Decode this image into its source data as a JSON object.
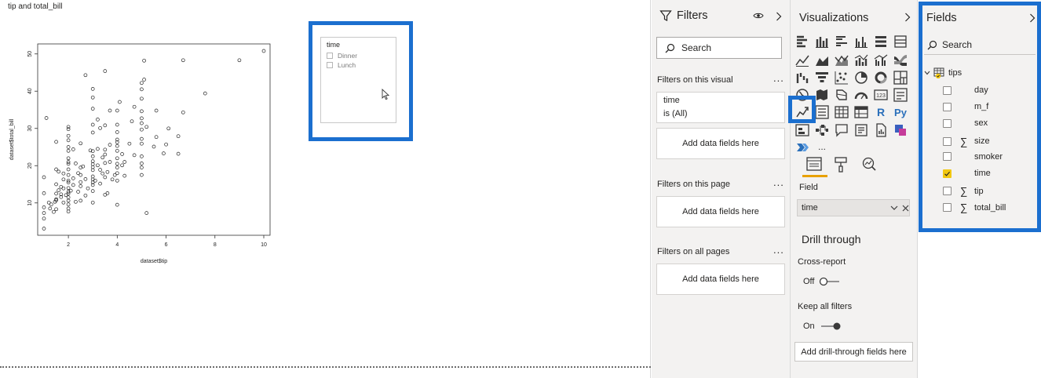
{
  "canvas": {
    "visual_title": "tip and total_bill",
    "slicer": {
      "title": "time",
      "items": [
        "Dinner",
        "Lunch"
      ]
    }
  },
  "chart_data": {
    "type": "scatter",
    "title": "",
    "xlabel": "dataset$tip",
    "ylabel": "dataset$total_bill",
    "xlim": [
      1,
      10
    ],
    "ylim": [
      3,
      51
    ],
    "x_ticks": [
      "2",
      "4",
      "6",
      "8",
      "10"
    ],
    "y_ticks": [
      "10",
      "20",
      "30",
      "40",
      "50"
    ],
    "grid": false,
    "legend": "none",
    "points": [
      [
        1.0,
        3.1
      ],
      [
        1.0,
        5.8
      ],
      [
        1.0,
        7.3
      ],
      [
        1.0,
        8.8
      ],
      [
        1.0,
        12.6
      ],
      [
        1.0,
        16.9
      ],
      [
        1.1,
        32.8
      ],
      [
        1.2,
        10.1
      ],
      [
        1.25,
        8.5
      ],
      [
        1.3,
        9.6
      ],
      [
        1.4,
        7.6
      ],
      [
        1.45,
        10.3
      ],
      [
        1.5,
        8.3
      ],
      [
        1.5,
        10.7
      ],
      [
        1.5,
        11.0
      ],
      [
        1.5,
        12.5
      ],
      [
        1.5,
        15.0
      ],
      [
        1.5,
        19.0
      ],
      [
        1.5,
        26.4
      ],
      [
        1.6,
        13.4
      ],
      [
        1.6,
        18.4
      ],
      [
        1.7,
        11.6
      ],
      [
        1.7,
        12.3
      ],
      [
        1.7,
        14.3
      ],
      [
        1.8,
        10.1
      ],
      [
        1.8,
        13.9
      ],
      [
        1.8,
        16.3
      ],
      [
        1.8,
        17.9
      ],
      [
        1.9,
        12.1
      ],
      [
        2.0,
        7.7
      ],
      [
        2.0,
        8.5
      ],
      [
        2.0,
        9.6
      ],
      [
        2.0,
        10.6
      ],
      [
        2.0,
        11.5
      ],
      [
        2.0,
        12.5
      ],
      [
        2.0,
        13.0
      ],
      [
        2.0,
        14.0
      ],
      [
        2.0,
        15.5
      ],
      [
        2.0,
        16.0
      ],
      [
        2.0,
        17.5
      ],
      [
        2.0,
        19.0
      ],
      [
        2.0,
        20.5
      ],
      [
        2.0,
        21.0
      ],
      [
        2.0,
        22.0
      ],
      [
        2.0,
        24.0
      ],
      [
        2.0,
        25.0
      ],
      [
        2.0,
        26.8
      ],
      [
        2.0,
        28.0
      ],
      [
        2.0,
        29.8
      ],
      [
        2.0,
        30.4
      ],
      [
        2.1,
        13.3
      ],
      [
        2.2,
        14.8
      ],
      [
        2.2,
        16.6
      ],
      [
        2.2,
        24.4
      ],
      [
        2.3,
        10.3
      ],
      [
        2.3,
        20.6
      ],
      [
        2.4,
        13.0
      ],
      [
        2.4,
        18.0
      ],
      [
        2.5,
        10.6
      ],
      [
        2.5,
        14.5
      ],
      [
        2.5,
        15.6
      ],
      [
        2.5,
        17.5
      ],
      [
        2.5,
        19.5
      ],
      [
        2.5,
        26.0
      ],
      [
        2.6,
        19.8
      ],
      [
        2.7,
        44.3
      ],
      [
        2.7,
        16.4
      ],
      [
        2.7,
        12.0
      ],
      [
        2.8,
        13.9
      ],
      [
        2.9,
        24.1
      ],
      [
        3.0,
        10.1
      ],
      [
        3.0,
        13.2
      ],
      [
        3.0,
        14.8
      ],
      [
        3.0,
        15.5
      ],
      [
        3.0,
        16.3
      ],
      [
        3.0,
        17.1
      ],
      [
        3.0,
        18.8
      ],
      [
        3.0,
        19.6
      ],
      [
        3.0,
        20.4
      ],
      [
        3.0,
        21.2
      ],
      [
        3.0,
        22.5
      ],
      [
        3.0,
        23.9
      ],
      [
        3.0,
        28.9
      ],
      [
        3.0,
        31.0
      ],
      [
        3.0,
        35.3
      ],
      [
        3.0,
        38.3
      ],
      [
        3.0,
        40.6
      ],
      [
        3.1,
        16.0
      ],
      [
        3.2,
        20.1
      ],
      [
        3.2,
        24.5
      ],
      [
        3.2,
        32.4
      ],
      [
        3.3,
        15.2
      ],
      [
        3.3,
        18.9
      ],
      [
        3.3,
        30.1
      ],
      [
        3.4,
        17.9
      ],
      [
        3.4,
        22.2
      ],
      [
        3.5,
        12.2
      ],
      [
        3.5,
        16.9
      ],
      [
        3.5,
        20.7
      ],
      [
        3.5,
        23.0
      ],
      [
        3.5,
        24.3
      ],
      [
        3.5,
        30.8
      ],
      [
        3.5,
        45.4
      ],
      [
        3.6,
        12.6
      ],
      [
        3.6,
        18.3
      ],
      [
        3.7,
        21.0
      ],
      [
        3.7,
        25.6
      ],
      [
        3.7,
        34.8
      ],
      [
        3.8,
        16.3
      ],
      [
        3.9,
        17.5
      ],
      [
        4.0,
        9.5
      ],
      [
        4.0,
        16.0
      ],
      [
        4.0,
        18.0
      ],
      [
        4.0,
        19.5
      ],
      [
        4.0,
        20.5
      ],
      [
        4.0,
        22.0
      ],
      [
        4.0,
        24.0
      ],
      [
        4.0,
        25.3
      ],
      [
        4.0,
        26.3
      ],
      [
        4.0,
        27.0
      ],
      [
        4.0,
        29.0
      ],
      [
        4.0,
        31.0
      ],
      [
        4.0,
        34.8
      ],
      [
        4.1,
        37.1
      ],
      [
        4.2,
        20.1
      ],
      [
        4.2,
        23.1
      ],
      [
        4.3,
        17.3
      ],
      [
        4.3,
        21.0
      ],
      [
        4.5,
        25.9
      ],
      [
        4.6,
        31.9
      ],
      [
        4.7,
        22.8
      ],
      [
        4.7,
        35.8
      ],
      [
        5.0,
        17.5
      ],
      [
        5.0,
        19.5
      ],
      [
        5.0,
        20.6
      ],
      [
        5.0,
        22.5
      ],
      [
        5.0,
        25.9
      ],
      [
        5.0,
        27.2
      ],
      [
        5.0,
        29.7
      ],
      [
        5.0,
        31.4
      ],
      [
        5.0,
        32.7
      ],
      [
        5.0,
        34.6
      ],
      [
        5.0,
        38.0
      ],
      [
        5.0,
        40.5
      ],
      [
        5.0,
        42.2
      ],
      [
        5.1,
        43.1
      ],
      [
        5.1,
        48.2
      ],
      [
        5.2,
        7.3
      ],
      [
        5.2,
        30.4
      ],
      [
        5.5,
        25.1
      ],
      [
        5.6,
        27.7
      ],
      [
        5.6,
        34.8
      ],
      [
        5.9,
        23.3
      ],
      [
        6.0,
        25.7
      ],
      [
        6.1,
        30.0
      ],
      [
        6.5,
        27.9
      ],
      [
        6.5,
        23.2
      ],
      [
        6.7,
        34.3
      ],
      [
        6.7,
        48.3
      ],
      [
        7.6,
        39.4
      ],
      [
        9.0,
        48.3
      ],
      [
        10.0,
        50.8
      ]
    ]
  },
  "filters_pane": {
    "title": "Filters",
    "search_placeholder": "Search",
    "on_this_visual_label": "Filters on this visual",
    "visual_filter_field": "time",
    "visual_filter_value": "is (All)",
    "add_fields_label": "Add data fields here",
    "on_this_page_label": "Filters on this page",
    "on_all_pages_label": "Filters on all pages",
    "more": "..."
  },
  "visualizations_pane": {
    "title": "Visualizations",
    "more": "...",
    "r_icon": "R",
    "py_icon": "Py",
    "field_label": "Field",
    "field_value": "time",
    "drill_through_title": "Drill through",
    "cross_report_label": "Cross-report",
    "cross_report_state": "Off",
    "keep_all_filters_label": "Keep all filters",
    "keep_all_filters_state": "On",
    "add_drill_label": "Add drill-through fields here"
  },
  "fields_pane": {
    "title": "Fields",
    "search_placeholder": "Search",
    "table_name": "tips",
    "fields": [
      {
        "name": "day",
        "sigma": false,
        "checked": false
      },
      {
        "name": "m_f",
        "sigma": false,
        "checked": false
      },
      {
        "name": "sex",
        "sigma": false,
        "checked": false
      },
      {
        "name": "size",
        "sigma": true,
        "checked": false
      },
      {
        "name": "smoker",
        "sigma": false,
        "checked": false
      },
      {
        "name": "time",
        "sigma": false,
        "checked": true
      },
      {
        "name": "tip",
        "sigma": true,
        "checked": false
      },
      {
        "name": "total_bill",
        "sigma": true,
        "checked": false
      }
    ]
  },
  "colors": {
    "highlight": "#1b6fcf",
    "accent": "#f2c811",
    "pane_bg": "#f3f2f1"
  }
}
